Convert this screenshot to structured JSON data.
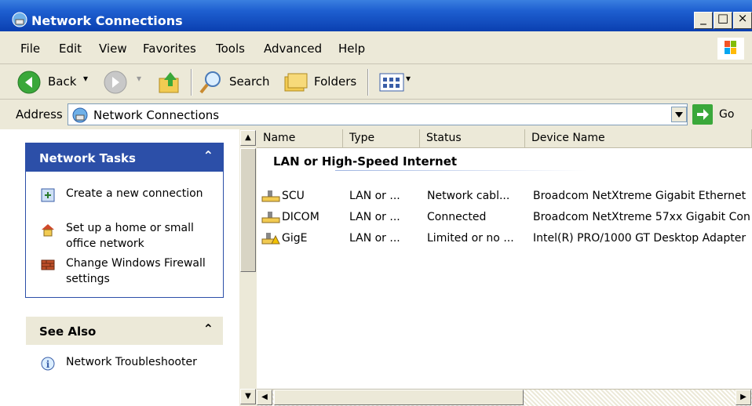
{
  "window": {
    "title": "Network Connections"
  },
  "menu": [
    "File",
    "Edit",
    "View",
    "Favorites",
    "Tools",
    "Advanced",
    "Help"
  ],
  "toolbar": {
    "back": "Back",
    "search": "Search",
    "folders": "Folders"
  },
  "address": {
    "label": "Address",
    "value": "Network Connections",
    "go": "Go"
  },
  "tasks_panel": {
    "title": "Network Tasks",
    "items": [
      {
        "icon": "new-connection-icon",
        "label": "Create a new connection"
      },
      {
        "icon": "home-network-icon",
        "label": "Set up a home or small office network"
      },
      {
        "icon": "firewall-icon",
        "label": "Change Windows Firewall settings"
      }
    ]
  },
  "see_also_panel": {
    "title": "See Also",
    "items": [
      {
        "icon": "info-icon",
        "label": "Network Troubleshooter"
      }
    ]
  },
  "list": {
    "columns": [
      "Name",
      "Type",
      "Status",
      "Device Name"
    ],
    "group": "LAN or High-Speed Internet",
    "rows": [
      {
        "name": "SCU",
        "type": "LAN or ...",
        "status": "Network cabl...",
        "device": "Broadcom NetXtreme Gigabit Ethernet"
      },
      {
        "name": "DICOM",
        "type": "LAN or ...",
        "status": "Connected",
        "device": "Broadcom NetXtreme 57xx Gigabit Con"
      },
      {
        "name": "GigE",
        "type": "LAN or ...",
        "status": "Limited or no ...",
        "device": "Intel(R) PRO/1000 GT Desktop Adapter"
      }
    ]
  },
  "colors": {
    "titlebar": "#0a3fb0",
    "panel_head": "#2c4fa8",
    "face": "#ece9d8"
  }
}
